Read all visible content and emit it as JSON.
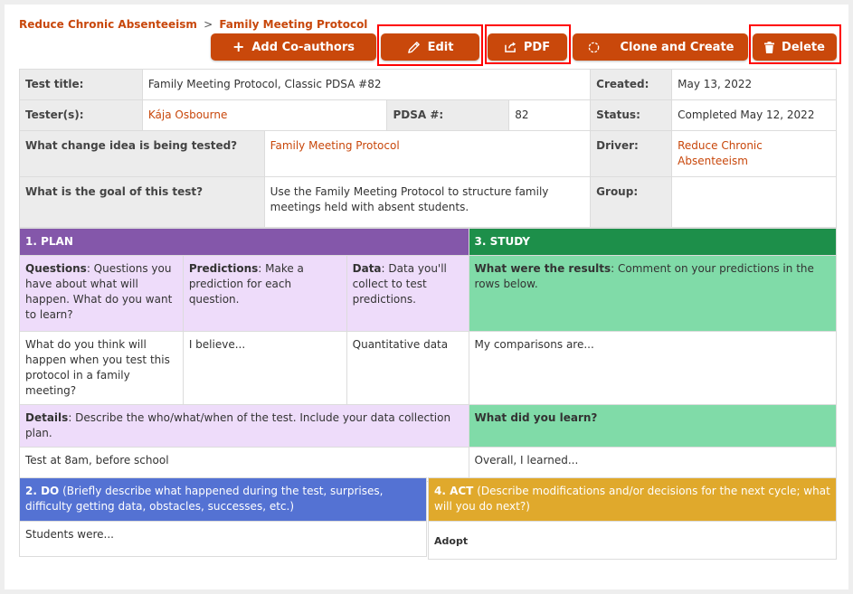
{
  "breadcrumb": {
    "parent": "Reduce Chronic Absenteeism",
    "separator": ">",
    "current": "Family Meeting Protocol"
  },
  "toolbar": {
    "add_coauthors": "Add Co-authors",
    "edit": "Edit",
    "pdf": "PDF",
    "clone": "Clone and Create",
    "delete": "Delete"
  },
  "details": {
    "test_title_label": "Test title:",
    "test_title": "Family Meeting Protocol, Classic PDSA #82",
    "created_label": "Created:",
    "created": "May 13, 2022",
    "testers_label": "Tester(s):",
    "testers": "Kája Osbourne",
    "pdsa_label": "PDSA #:",
    "pdsa": "82",
    "status_label": "Status:",
    "status": "Completed May 12, 2022",
    "change_idea_label": "What change idea is being tested?",
    "change_idea": "Family Meeting Protocol",
    "driver_label": "Driver:",
    "driver": "Reduce Chronic Absenteeism",
    "goal_label": "What is the goal of this test?",
    "goal": "Use the Family Meeting Protocol to structure family meetings held with absent students.",
    "group_label": "Group:",
    "group": ""
  },
  "plan": {
    "header": "1. PLAN",
    "questions_title": "Questions",
    "questions_desc": ": Questions you have about what will happen. What do you want to learn?",
    "predictions_title": "Predictions",
    "predictions_desc": ": Make a prediction for each question.",
    "data_title": "Data",
    "data_desc": ": Data you'll collect to test predictions.",
    "question_value": "What do you think will happen when you test this protocol in a family meeting?",
    "prediction_value": "I believe...",
    "data_value": "Quantitative data",
    "details_title": "Details",
    "details_desc": ": Describe the who/what/when of the test. Include your data collection plan.",
    "details_value": "Test at 8am, before school"
  },
  "study": {
    "header": "3. STUDY",
    "results_title": "What were the results",
    "results_desc": ": Comment on your predictions in the rows below.",
    "results_value": "My comparisons are...",
    "learn_title": "What did you learn?",
    "learn_value": "Overall, I learned..."
  },
  "do": {
    "header_title": "2. DO",
    "header_desc": " (Briefly describe what happened during the test, surprises, difficulty getting data, obstacles, successes, etc.)",
    "value": "Students were..."
  },
  "act": {
    "header_title": "4. ACT",
    "header_desc": " (Describe modifications and/or decisions for the next cycle; what will you do next?)",
    "value": "Adopt"
  }
}
